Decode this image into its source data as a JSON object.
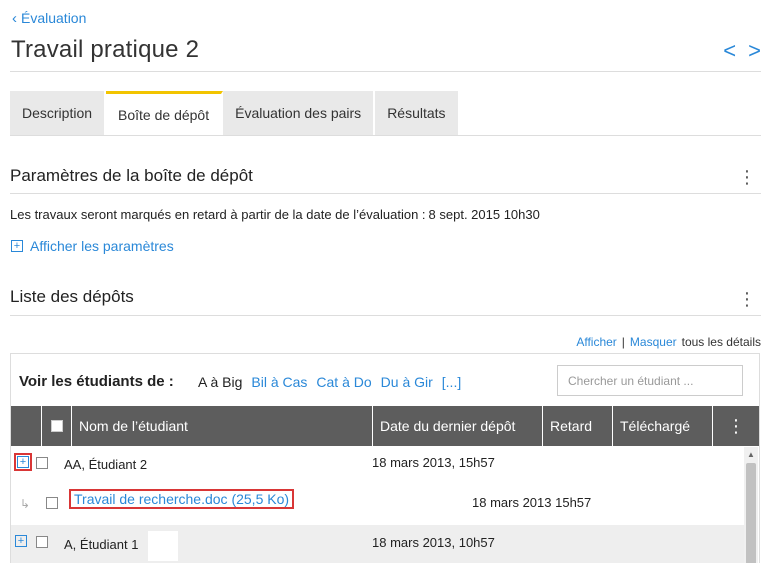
{
  "breadcrumb": {
    "label": "Évaluation"
  },
  "page": {
    "title": "Travail pratique 2"
  },
  "pager": {
    "prev": "<",
    "next": ">"
  },
  "tabs": [
    {
      "label": "Description"
    },
    {
      "label": "Boîte de dépôt",
      "active": true
    },
    {
      "label": "Évaluation des pairs"
    },
    {
      "label": "Résultats"
    }
  ],
  "params_section": {
    "title": "Paramètres de la boîte de dépôt",
    "late_label": "Les travaux seront marqués en retard à partir de la date de l’évaluation :",
    "late_value": "8 sept. 2015 10h30",
    "show_params": "Afficher les paramètres"
  },
  "submissions_section": {
    "title": "Liste des dépôts",
    "details": {
      "show": "Afficher",
      "separator": "|",
      "hide": "Masquer",
      "suffix": "tous les détails"
    },
    "filter_label": "Voir les étudiants de :",
    "filters": [
      "A à Big",
      "Bil à Cas",
      "Cat à Do",
      "Du à Gir",
      "[...]"
    ],
    "search_placeholder": "Chercher un étudiant ...",
    "columns": [
      "Nom de l’étudiant",
      "Date du dernier dépôt",
      "Retard",
      "Téléchargé"
    ],
    "rows": [
      {
        "name": "AA, Étudiant 2",
        "date": "18 mars 2013, 15h57"
      },
      {
        "file": "Travail de recherche.doc (25,5 Ko)",
        "date": "18 mars 2013 15h57"
      },
      {
        "name": "A, Étudiant 1",
        "date": "18 mars 2013, 10h57"
      }
    ]
  },
  "colors": {
    "accent": "#2a88d8",
    "tab_highlight": "#f2c400",
    "header_bg": "#5d5d5d",
    "highlight_box": "#d93636"
  }
}
